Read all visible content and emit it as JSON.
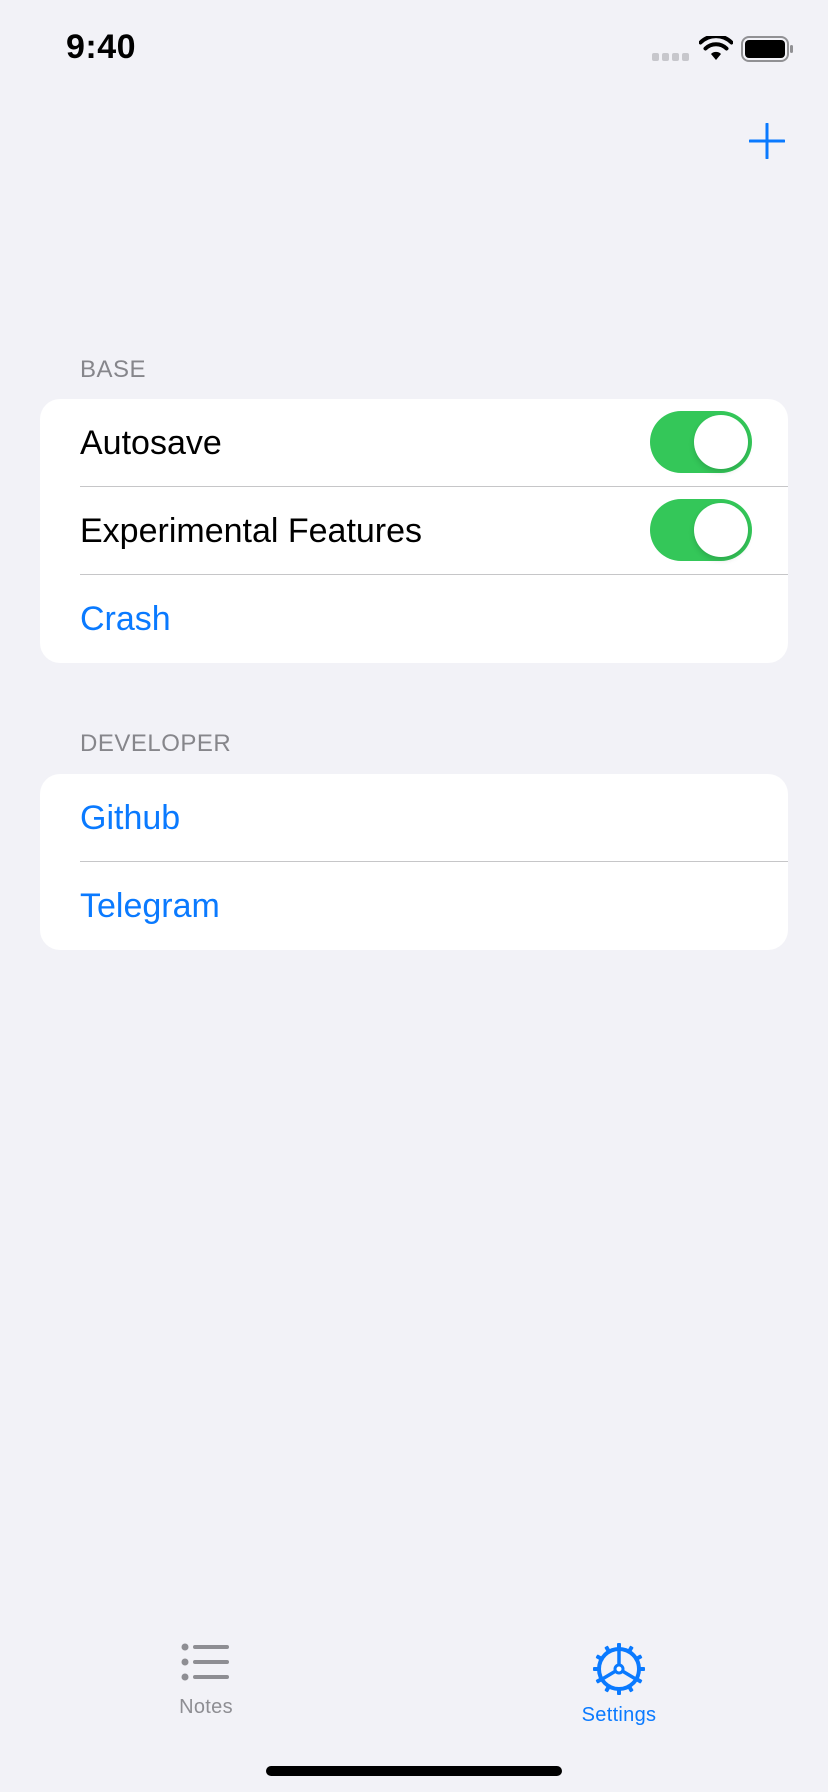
{
  "status_bar": {
    "time": "9:40"
  },
  "nav": {
    "add_icon": "plus-icon"
  },
  "sections": {
    "base": {
      "header": "BASE",
      "autosave_label": "Autosave",
      "autosave_on": true,
      "experimental_label": "Experimental Features",
      "experimental_on": true,
      "crash_label": "Crash"
    },
    "developer": {
      "header": "DEVELOPER",
      "github_label": "Github",
      "telegram_label": "Telegram"
    }
  },
  "tab_bar": {
    "notes_label": "Notes",
    "notes_icon": "list-icon",
    "settings_label": "Settings",
    "settings_icon": "gear-icon",
    "active": "Settings"
  },
  "colors": {
    "accent": "#0a7aff",
    "toggle_on": "#34c759",
    "background": "#f2f2f7",
    "inactive_tab": "#8e8e93"
  }
}
